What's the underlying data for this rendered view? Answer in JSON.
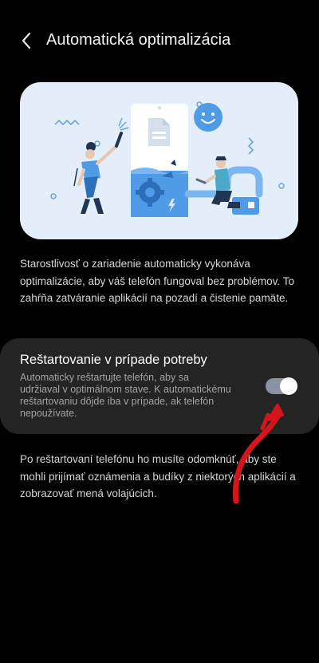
{
  "header": {
    "title": "Automatická optimalizácia",
    "back_icon": "chevron-left-icon"
  },
  "illustration": {
    "icons": [
      "document-icon",
      "smiley-icon",
      "gear-icon",
      "lightning-icon"
    ],
    "colors": {
      "background": "#e4eefa",
      "accent_blue": "#4f9be8",
      "dark_navy": "#1f3550",
      "teal": "#4aa8c8"
    }
  },
  "description": "Starostlivosť o zariadenie automaticky vykonáva optimalizácie, aby váš telefón fungoval bez problémov. To zahŕňa zatváranie aplikácií na pozadí a čistenie pamäte.",
  "restart_setting": {
    "title": "Reštartovanie v prípade potreby",
    "subtitle": "Automaticky reštartujte telefón, aby sa udržiaval v optimálnom stave. K automatickému reštartovaniu dôjde iba v prípade, ak telefón nepoužívate.",
    "enabled": true,
    "toggle_color": "#8a93a6"
  },
  "note": "Po reštartovaní telefónu ho musíte odomknúť, aby ste mohli prijímať oznámenia a budíky z niektorých aplikácií a zobrazovať mená volajúcich.",
  "annotation": {
    "arrow_color": "#d5141b"
  }
}
